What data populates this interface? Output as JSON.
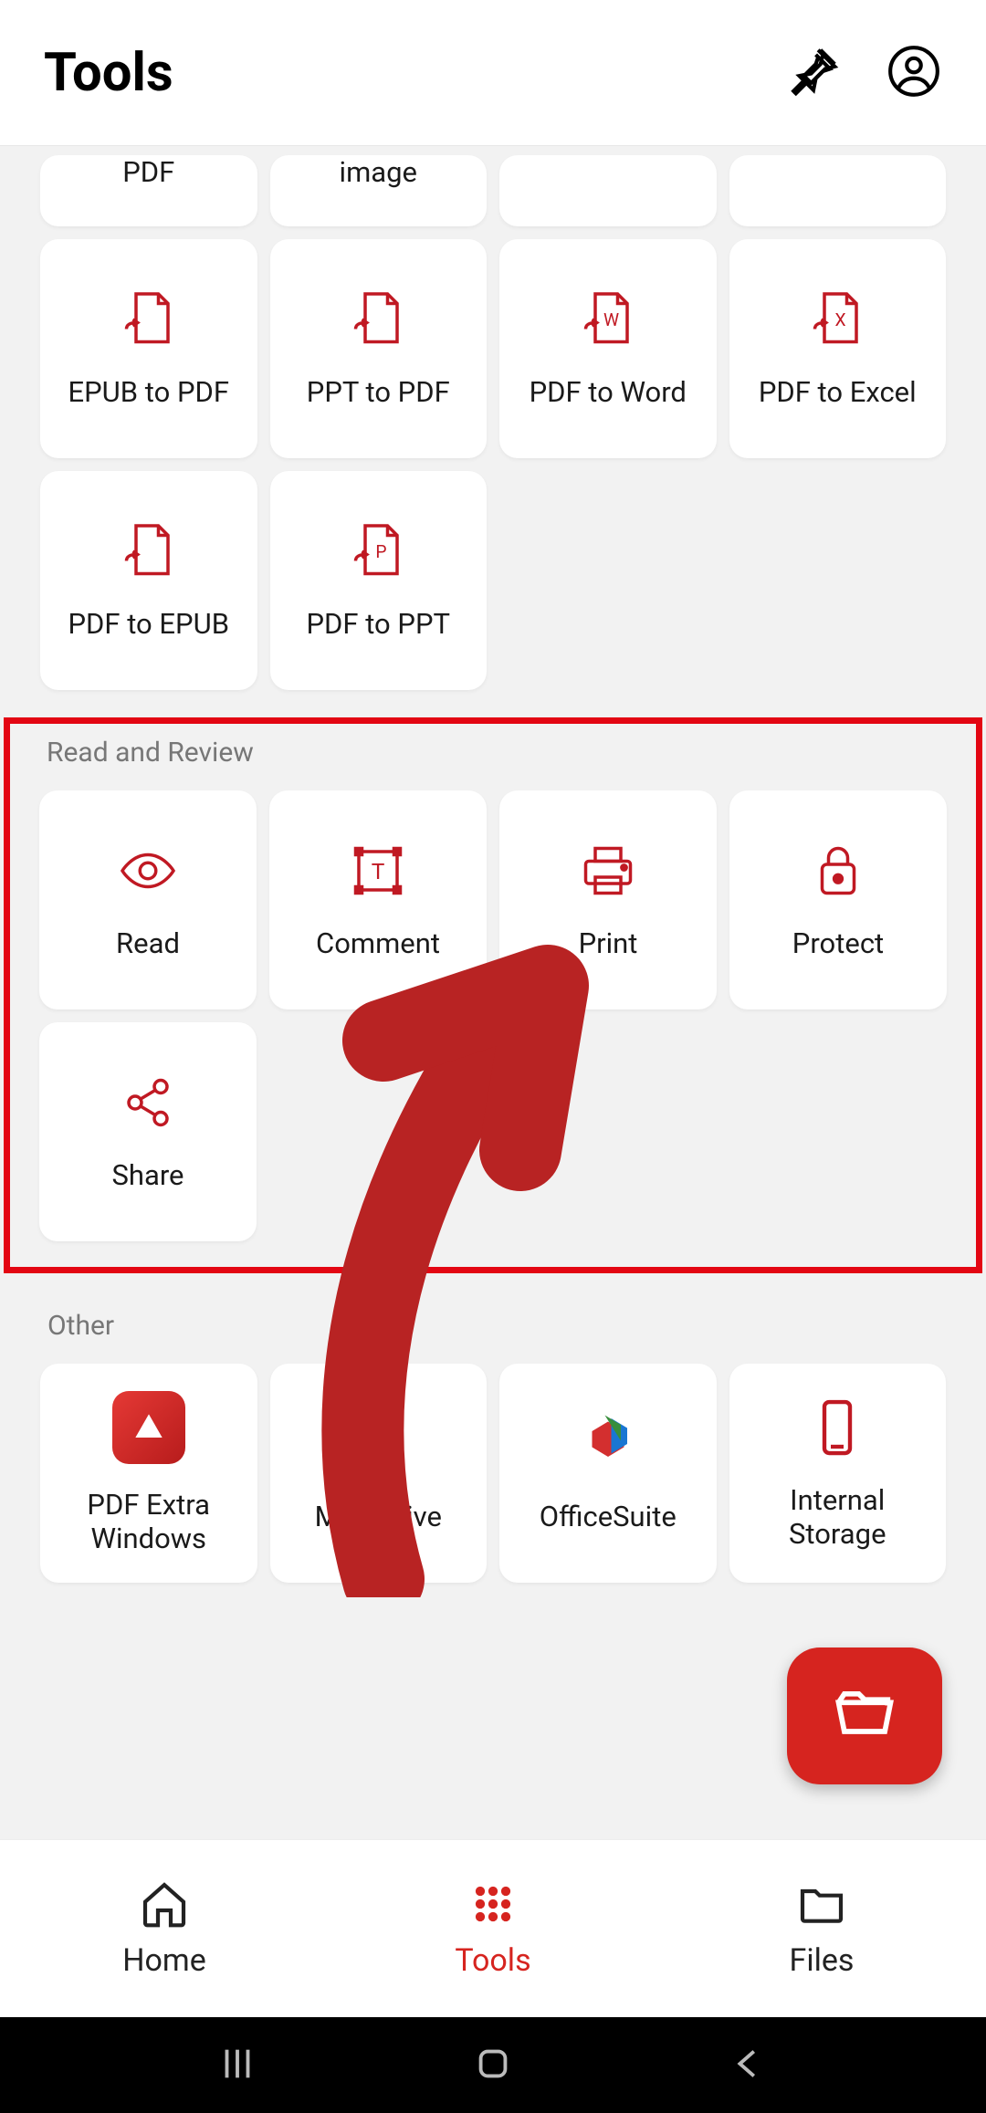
{
  "header": {
    "title": "Tools"
  },
  "accent": "#c01923",
  "convert_partial": [
    {
      "label": "PDF"
    },
    {
      "label": "image"
    },
    {
      "label": ""
    },
    {
      "label": ""
    }
  ],
  "convert": [
    {
      "label": "EPUB to PDF",
      "glyph": ""
    },
    {
      "label": "PPT to PDF",
      "glyph": ""
    },
    {
      "label": "PDF to Word",
      "glyph": "W"
    },
    {
      "label": "PDF to Excel",
      "glyph": "X"
    },
    {
      "label": "PDF to EPUB",
      "glyph": ""
    },
    {
      "label": "PDF to PPT",
      "glyph": "P"
    }
  ],
  "read_review": {
    "title": "Read and Review",
    "items": [
      {
        "label": "Read"
      },
      {
        "label": "Comment"
      },
      {
        "label": "Print"
      },
      {
        "label": "Protect"
      },
      {
        "label": "Share"
      }
    ]
  },
  "other": {
    "title": "Other",
    "items": [
      {
        "label": "PDF Extra Windows"
      },
      {
        "label": "MobiDrive"
      },
      {
        "label": "OfficeSuite"
      },
      {
        "label": "Internal Storage"
      }
    ]
  },
  "nav": {
    "home": "Home",
    "tools": "Tools",
    "files": "Files"
  }
}
